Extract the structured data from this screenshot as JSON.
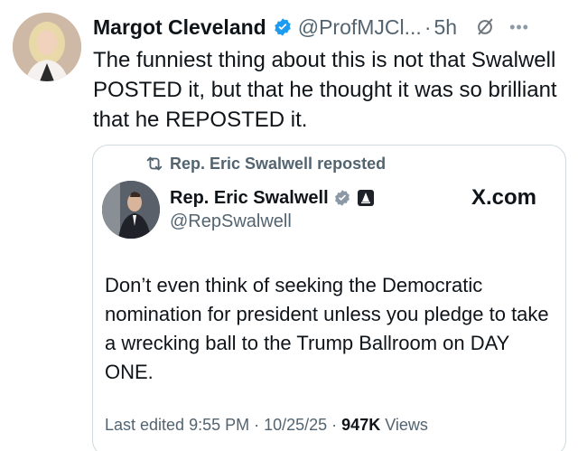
{
  "tweet": {
    "author_name": "Margot Cleveland",
    "handle": "@ProfMJCl...",
    "separator": "·",
    "time": "5h",
    "text": "The funniest thing about this is not that Swalwell POSTED it, but that he thought it was so brilliant that he REPOSTED it."
  },
  "quote": {
    "repost_label": "Rep. Eric Swalwell reposted",
    "author_name": "Rep. Eric Swalwell",
    "handle": "@RepSwalwell",
    "source": "X.com",
    "text": "Don’t even think of seeking the Democratic nomination for president unless you pledge to take a wrecking ball to the Trump Ballroom on DAY ONE.",
    "footer_prefix": "Last edited 9:55 PM · 10/25/25 · ",
    "views_count": "947K",
    "views_label": " Views"
  },
  "icons": {
    "verified": "verified-badge-icon",
    "grok": "grok-icon",
    "more": "more-icon",
    "repost": "repost-icon",
    "government": "government-badge-icon"
  },
  "colors": {
    "verified_blue": "#1d9bf0",
    "secondary_text": "#536471",
    "border": "#cfd9de"
  }
}
